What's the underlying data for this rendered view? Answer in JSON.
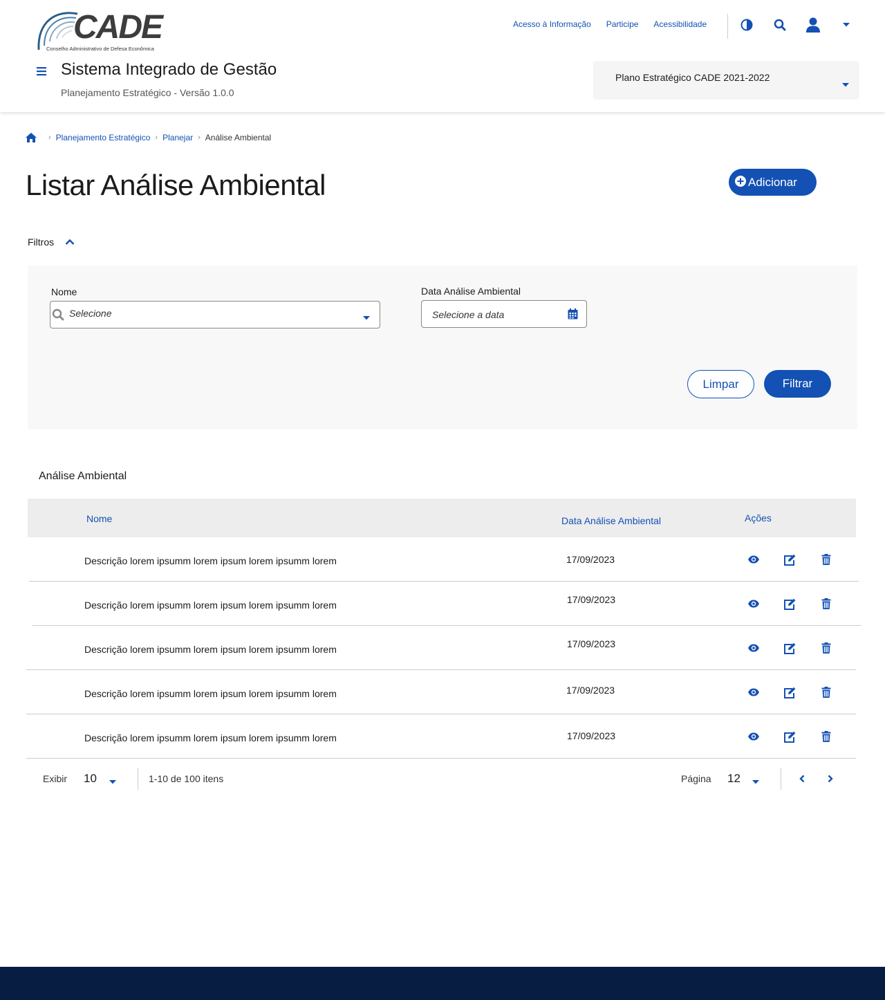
{
  "header": {
    "logo_text": "CADE",
    "logo_subtitle": "Conselho Administrativo de Defesa Econômica",
    "links": [
      "Acesso à Informação",
      "Participe",
      "Acessibilidade"
    ],
    "system_title": "Sistema Integrado de Gestão",
    "system_subtitle": "Planejamento Estratégico - Versão 1.0.0",
    "plan_selected": "Plano Estratégico CADE 2021-2022",
    "icons": [
      "contrast-icon",
      "search-icon",
      "user-icon",
      "caret-down-icon"
    ]
  },
  "breadcrumb": {
    "items": [
      "Planejamento Estratégico",
      "Planejar"
    ],
    "current": "Análise Ambiental"
  },
  "page": {
    "title": "Listar Análise Ambiental",
    "add_label": "Adicionar"
  },
  "filters": {
    "toggle_label": "Filtros",
    "name_label": "Nome",
    "name_placeholder": "Selecione",
    "date_label": "Data  Análise Ambiental",
    "date_placeholder": "Selecione a data",
    "clear_label": "Limpar",
    "filter_label": "Filtrar"
  },
  "table": {
    "title": "Análise Ambiental",
    "columns": [
      "Nome",
      "Data  Análise Ambiental",
      "Ações"
    ],
    "rows": [
      {
        "name": "Descrição lorem ipsumm lorem ipsum lorem ipsumm lorem",
        "date": "17/09/2023"
      },
      {
        "name": "Descrição lorem ipsumm lorem ipsum lorem ipsumm lorem",
        "date": "17/09/2023"
      },
      {
        "name": "Descrição lorem ipsumm lorem ipsum lorem ipsumm lorem",
        "date": "17/09/2023"
      },
      {
        "name": "Descrição lorem ipsumm lorem ipsum lorem ipsumm lorem",
        "date": "17/09/2023"
      },
      {
        "name": "Descrição lorem ipsumm lorem ipsum lorem ipsumm lorem",
        "date": "17/09/2023"
      }
    ]
  },
  "pagination": {
    "show_label": "Exibir",
    "per_page": "10",
    "range_text": "1-10 de 100 itens",
    "page_label": "Página",
    "page_number": "12"
  },
  "colors": {
    "primary": "#1351b4",
    "footer": "#071d41",
    "filter_bg": "#f8f8f8",
    "table_header_bg": "#ededed"
  }
}
